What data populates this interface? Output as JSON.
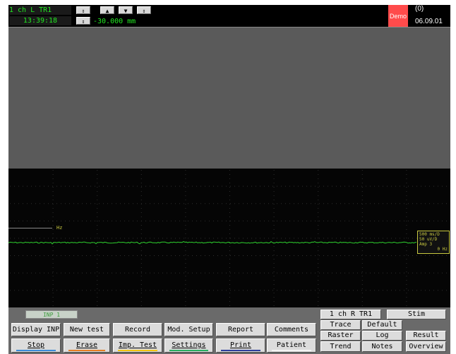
{
  "header": {
    "channel_label": "1 ch L TR1",
    "time": "13:39:18",
    "position_value": "-30.000 mm",
    "demo_badge": "Demo",
    "counter": "(0)",
    "date": "06.09.01"
  },
  "waveform": {
    "hz_label": "Hz",
    "scale_lines": [
      "500 ms/D",
      "50 uV/D",
      "Amp 3",
      "0 Hz"
    ]
  },
  "panel": {
    "status_text": "INP 1",
    "channel_button": "1 ch R TR1",
    "stim_button": "Stim",
    "row1": [
      "Display INP",
      "New test",
      "Record",
      "Mod. Setup",
      "Report",
      "Comments"
    ],
    "row2": [
      "Stop",
      "Erase",
      "Imp. Test",
      "Settings",
      "Print",
      "Patient"
    ],
    "right_grid": [
      "Trace",
      "Default",
      "Raster",
      "Log",
      "Result",
      "Trend",
      "Notes",
      "Overview"
    ]
  },
  "colors": {
    "trace": "#2fd12f",
    "demo": "#ff4b4b",
    "stop_bar": "#3b8bd8",
    "erase_bar": "#e67e22",
    "imp_bar": "#f1c40f",
    "settings_bar": "#27ae60",
    "print_bar": "#2c3e9c",
    "patient_bar": "#f4f4f4"
  }
}
